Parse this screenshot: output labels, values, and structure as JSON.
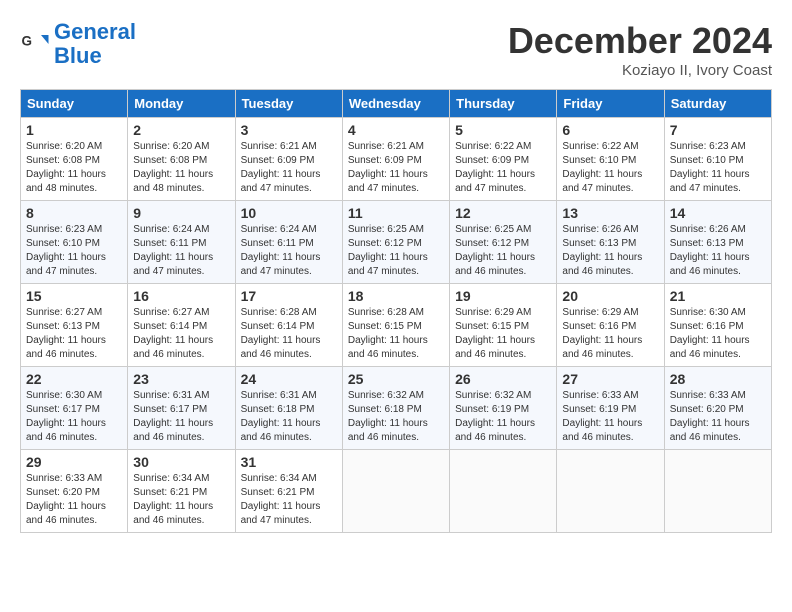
{
  "logo": {
    "line1": "General",
    "line2": "Blue"
  },
  "header": {
    "title": "December 2024",
    "subtitle": "Koziayo II, Ivory Coast"
  },
  "columns": [
    "Sunday",
    "Monday",
    "Tuesday",
    "Wednesday",
    "Thursday",
    "Friday",
    "Saturday"
  ],
  "weeks": [
    [
      {
        "day": "1",
        "info": "Sunrise: 6:20 AM\nSunset: 6:08 PM\nDaylight: 11 hours\nand 48 minutes."
      },
      {
        "day": "2",
        "info": "Sunrise: 6:20 AM\nSunset: 6:08 PM\nDaylight: 11 hours\nand 48 minutes."
      },
      {
        "day": "3",
        "info": "Sunrise: 6:21 AM\nSunset: 6:09 PM\nDaylight: 11 hours\nand 47 minutes."
      },
      {
        "day": "4",
        "info": "Sunrise: 6:21 AM\nSunset: 6:09 PM\nDaylight: 11 hours\nand 47 minutes."
      },
      {
        "day": "5",
        "info": "Sunrise: 6:22 AM\nSunset: 6:09 PM\nDaylight: 11 hours\nand 47 minutes."
      },
      {
        "day": "6",
        "info": "Sunrise: 6:22 AM\nSunset: 6:10 PM\nDaylight: 11 hours\nand 47 minutes."
      },
      {
        "day": "7",
        "info": "Sunrise: 6:23 AM\nSunset: 6:10 PM\nDaylight: 11 hours\nand 47 minutes."
      }
    ],
    [
      {
        "day": "8",
        "info": "Sunrise: 6:23 AM\nSunset: 6:10 PM\nDaylight: 11 hours\nand 47 minutes."
      },
      {
        "day": "9",
        "info": "Sunrise: 6:24 AM\nSunset: 6:11 PM\nDaylight: 11 hours\nand 47 minutes."
      },
      {
        "day": "10",
        "info": "Sunrise: 6:24 AM\nSunset: 6:11 PM\nDaylight: 11 hours\nand 47 minutes."
      },
      {
        "day": "11",
        "info": "Sunrise: 6:25 AM\nSunset: 6:12 PM\nDaylight: 11 hours\nand 47 minutes."
      },
      {
        "day": "12",
        "info": "Sunrise: 6:25 AM\nSunset: 6:12 PM\nDaylight: 11 hours\nand 46 minutes."
      },
      {
        "day": "13",
        "info": "Sunrise: 6:26 AM\nSunset: 6:13 PM\nDaylight: 11 hours\nand 46 minutes."
      },
      {
        "day": "14",
        "info": "Sunrise: 6:26 AM\nSunset: 6:13 PM\nDaylight: 11 hours\nand 46 minutes."
      }
    ],
    [
      {
        "day": "15",
        "info": "Sunrise: 6:27 AM\nSunset: 6:13 PM\nDaylight: 11 hours\nand 46 minutes."
      },
      {
        "day": "16",
        "info": "Sunrise: 6:27 AM\nSunset: 6:14 PM\nDaylight: 11 hours\nand 46 minutes."
      },
      {
        "day": "17",
        "info": "Sunrise: 6:28 AM\nSunset: 6:14 PM\nDaylight: 11 hours\nand 46 minutes."
      },
      {
        "day": "18",
        "info": "Sunrise: 6:28 AM\nSunset: 6:15 PM\nDaylight: 11 hours\nand 46 minutes."
      },
      {
        "day": "19",
        "info": "Sunrise: 6:29 AM\nSunset: 6:15 PM\nDaylight: 11 hours\nand 46 minutes."
      },
      {
        "day": "20",
        "info": "Sunrise: 6:29 AM\nSunset: 6:16 PM\nDaylight: 11 hours\nand 46 minutes."
      },
      {
        "day": "21",
        "info": "Sunrise: 6:30 AM\nSunset: 6:16 PM\nDaylight: 11 hours\nand 46 minutes."
      }
    ],
    [
      {
        "day": "22",
        "info": "Sunrise: 6:30 AM\nSunset: 6:17 PM\nDaylight: 11 hours\nand 46 minutes."
      },
      {
        "day": "23",
        "info": "Sunrise: 6:31 AM\nSunset: 6:17 PM\nDaylight: 11 hours\nand 46 minutes."
      },
      {
        "day": "24",
        "info": "Sunrise: 6:31 AM\nSunset: 6:18 PM\nDaylight: 11 hours\nand 46 minutes."
      },
      {
        "day": "25",
        "info": "Sunrise: 6:32 AM\nSunset: 6:18 PM\nDaylight: 11 hours\nand 46 minutes."
      },
      {
        "day": "26",
        "info": "Sunrise: 6:32 AM\nSunset: 6:19 PM\nDaylight: 11 hours\nand 46 minutes."
      },
      {
        "day": "27",
        "info": "Sunrise: 6:33 AM\nSunset: 6:19 PM\nDaylight: 11 hours\nand 46 minutes."
      },
      {
        "day": "28",
        "info": "Sunrise: 6:33 AM\nSunset: 6:20 PM\nDaylight: 11 hours\nand 46 minutes."
      }
    ],
    [
      {
        "day": "29",
        "info": "Sunrise: 6:33 AM\nSunset: 6:20 PM\nDaylight: 11 hours\nand 46 minutes."
      },
      {
        "day": "30",
        "info": "Sunrise: 6:34 AM\nSunset: 6:21 PM\nDaylight: 11 hours\nand 46 minutes."
      },
      {
        "day": "31",
        "info": "Sunrise: 6:34 AM\nSunset: 6:21 PM\nDaylight: 11 hours\nand 47 minutes."
      },
      {
        "day": "",
        "info": ""
      },
      {
        "day": "",
        "info": ""
      },
      {
        "day": "",
        "info": ""
      },
      {
        "day": "",
        "info": ""
      }
    ]
  ]
}
